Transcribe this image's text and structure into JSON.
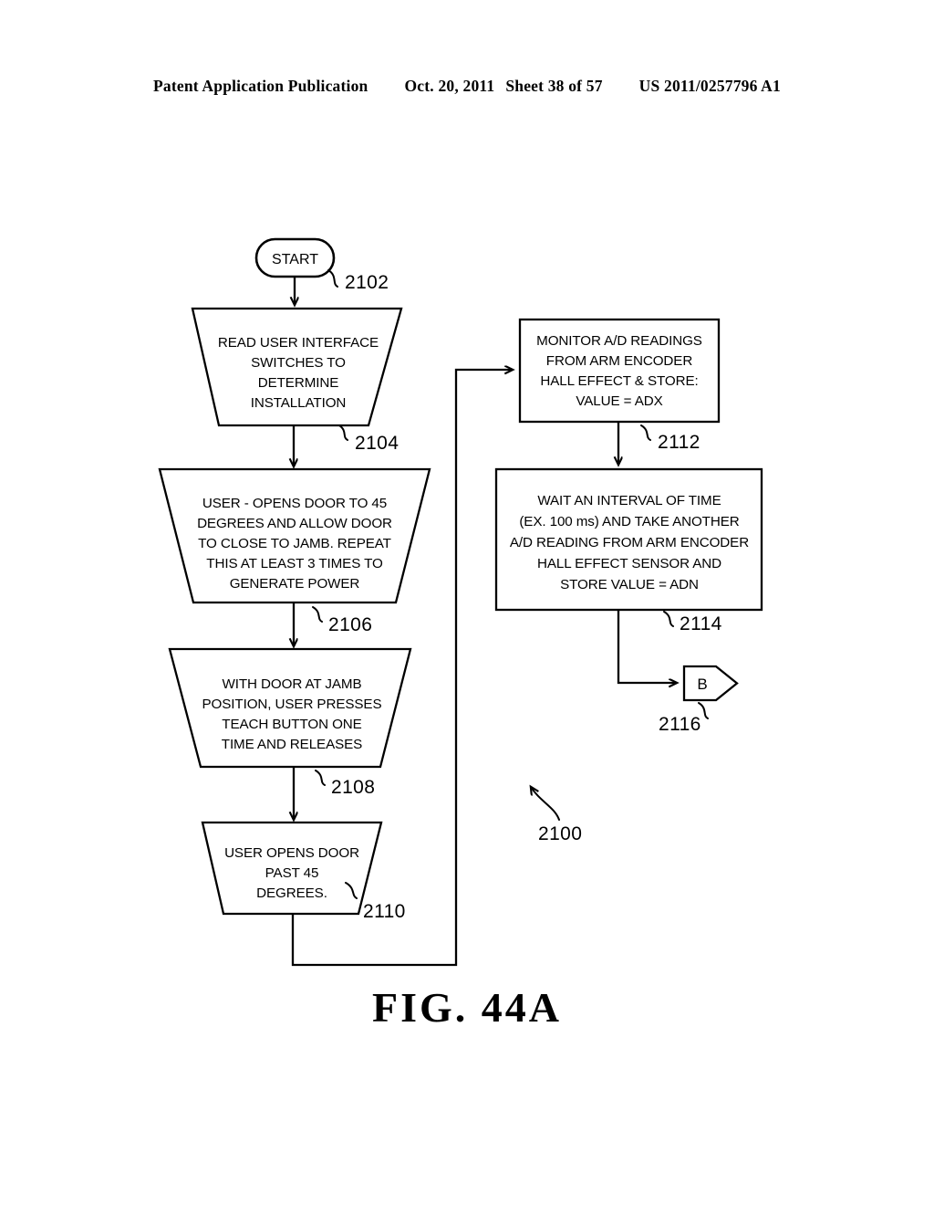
{
  "header": {
    "publication": "Patent Application Publication",
    "date": "Oct. 20, 2011",
    "sheet": "Sheet 38 of 57",
    "patent_number": "US 2011/0257796 A1"
  },
  "figure": {
    "caption": "FIG. 44A",
    "diagram_reference": "2100",
    "type": "flowchart"
  },
  "nodes": {
    "start": {
      "label": "START",
      "ref": "2102",
      "shape": "rounded-oval"
    },
    "n2104": {
      "ref": "2104",
      "shape": "trapezoid",
      "lines": [
        "READ USER INTERFACE",
        "SWITCHES TO",
        "DETERMINE",
        "INSTALLATION"
      ]
    },
    "n2106": {
      "ref": "2106",
      "shape": "trapezoid",
      "lines": [
        "USER - OPENS DOOR TO 45",
        "DEGREES AND ALLOW  DOOR",
        "TO CLOSE TO JAMB.  REPEAT",
        "THIS AT LEAST 3 TIMES TO",
        "GENERATE POWER"
      ]
    },
    "n2108": {
      "ref": "2108",
      "shape": "trapezoid",
      "lines": [
        "WITH DOOR AT JAMB",
        "POSITION, USER PRESSES",
        "TEACH BUTTON ONE",
        "TIME AND RELEASES"
      ]
    },
    "n2110": {
      "ref": "2110",
      "shape": "trapezoid",
      "lines": [
        "USER OPENS DOOR",
        "PAST 45",
        "DEGREES."
      ]
    },
    "n2112": {
      "ref": "2112",
      "shape": "rectangle",
      "lines": [
        "MONITOR A/D READINGS",
        "FROM ARM ENCODER",
        "HALL EFFECT & STORE:",
        "VALUE = ADX"
      ]
    },
    "n2114": {
      "ref": "2114",
      "shape": "rectangle",
      "lines": [
        "WAIT AN INTERVAL OF TIME",
        "(EX. 100 ms)  AND TAKE ANOTHER",
        "A/D READING FROM ARM ENCODER",
        "HALL EFFECT SENSOR AND",
        "STORE VALUE = ADN"
      ]
    },
    "n2116": {
      "ref": "2116",
      "shape": "off-page-connector",
      "label": "B"
    }
  },
  "colors": {
    "ink": "#000000",
    "paper": "#ffffff"
  }
}
